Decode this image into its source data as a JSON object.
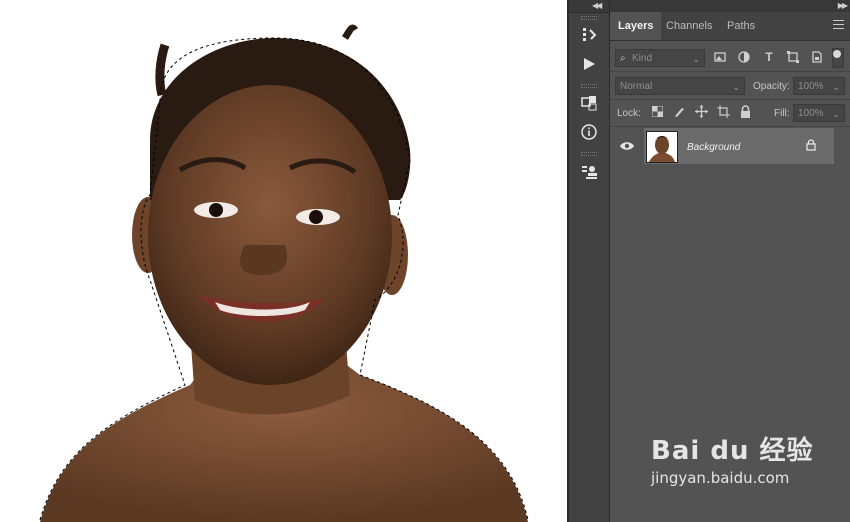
{
  "panel": {
    "tabs": [
      "Layers",
      "Channels",
      "Paths"
    ],
    "active_tab": "Layers",
    "filter": {
      "placeholder": "Kind"
    },
    "blend_mode": "Normal",
    "opacity_label": "Opacity:",
    "opacity_value": "100%",
    "lock_label": "Lock:",
    "fill_label": "Fill:",
    "fill_value": "100%",
    "layers": [
      {
        "name": "Background",
        "visible": true,
        "locked": true
      }
    ]
  },
  "toolbar": {
    "icons": [
      "history-icon",
      "play-actions-icon",
      "3d-icon",
      "info-icon",
      "clone-source-icon"
    ]
  },
  "watermark": {
    "logo": "Bai du 经验",
    "url": "jingyan.baidu.com"
  },
  "colors": {
    "panel_bg": "#535353",
    "tab_bar": "#424242",
    "selected_layer": "#6b6b6b",
    "canvas_bg": "#ffffff"
  }
}
